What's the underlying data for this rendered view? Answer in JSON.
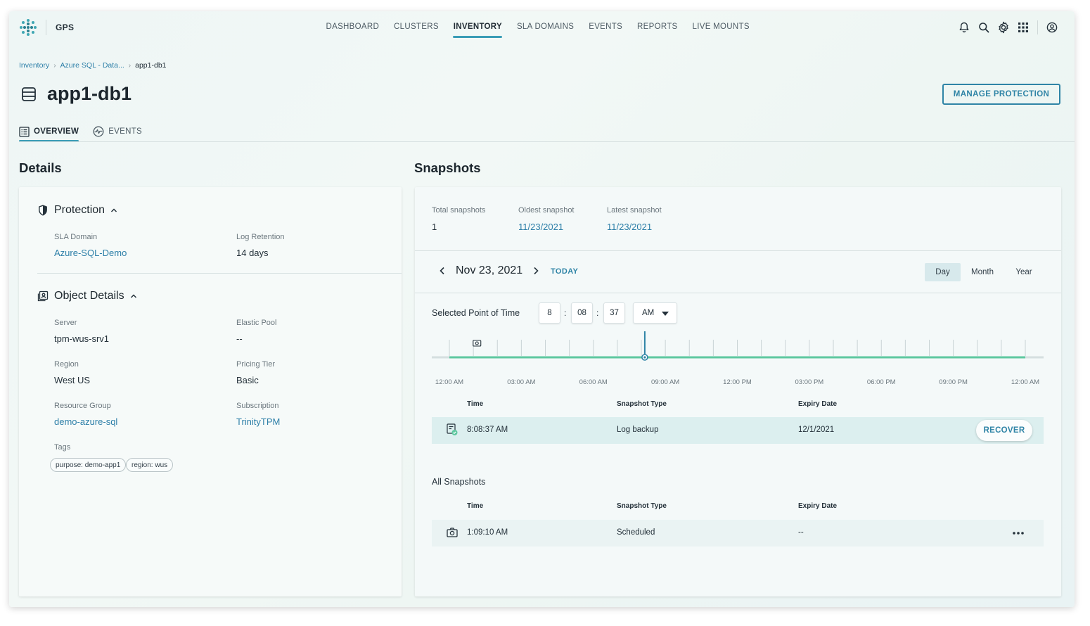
{
  "topnav": {
    "brand": "GPS",
    "items": [
      {
        "label": "DASHBOARD",
        "active": false
      },
      {
        "label": "CLUSTERS",
        "active": false
      },
      {
        "label": "INVENTORY",
        "active": true
      },
      {
        "label": "SLA DOMAINS",
        "active": false
      },
      {
        "label": "EVENTS",
        "active": false
      },
      {
        "label": "REPORTS",
        "active": false
      },
      {
        "label": "LIVE MOUNTS",
        "active": false
      }
    ],
    "icons": [
      "bell-icon",
      "search-icon",
      "gear-icon",
      "apps-grid-icon",
      "user-icon"
    ]
  },
  "breadcrumb": {
    "items": [
      "Inventory",
      "Azure SQL - Data...",
      "app1-db1"
    ]
  },
  "page": {
    "title": "app1-db1",
    "manage_button": "MANAGE PROTECTION",
    "tabs": [
      "OVERVIEW",
      "EVENTS"
    ]
  },
  "details": {
    "heading": "Details",
    "protection": {
      "title": "Protection",
      "sla_label": "SLA Domain",
      "sla_value": "Azure-SQL-Demo",
      "retention_label": "Log Retention",
      "retention_value": "14 days"
    },
    "object": {
      "title": "Object Details",
      "server_label": "Server",
      "server_value": "tpm-wus-srv1",
      "pool_label": "Elastic Pool",
      "pool_value": "--",
      "region_label": "Region",
      "region_value": "West US",
      "tier_label": "Pricing Tier",
      "tier_value": "Basic",
      "rg_label": "Resource Group",
      "rg_value": "demo-azure-sql",
      "sub_label": "Subscription",
      "sub_value": "TrinityTPM",
      "tags_label": "Tags",
      "tags": [
        "purpose: demo-app1",
        "region: wus"
      ]
    }
  },
  "snapshots": {
    "heading": "Snapshots",
    "total_label": "Total snapshots",
    "total_value": "1",
    "oldest_label": "Oldest snapshot",
    "oldest_value": "11/23/2021",
    "latest_label": "Latest snapshot",
    "latest_value": "11/23/2021",
    "date": "Nov 23, 2021",
    "today": "TODAY",
    "ranges": [
      "Day",
      "Month",
      "Year"
    ],
    "active_range": "Day",
    "spt_label": "Selected Point of Time",
    "time": {
      "hour": "8",
      "minute": "08",
      "second": "37",
      "ampm": "AM"
    },
    "timeline": {
      "labels": [
        "12:00 AM",
        "03:00 AM",
        "06:00 AM",
        "09:00 AM",
        "12:00 PM",
        "03:00 PM",
        "06:00 PM",
        "09:00 PM",
        "12:00 AM"
      ],
      "selected_hours": 8.1436,
      "snapshot_hours": 1.15
    },
    "columns": [
      "Time",
      "Snapshot Type",
      "Expiry Date"
    ],
    "selected_row": {
      "time": "8:08:37 AM",
      "type": "Log backup",
      "expiry": "12/1/2021",
      "action": "RECOVER"
    },
    "all_heading": "All Snapshots",
    "all_rows": [
      {
        "time": "1:09:10 AM",
        "type": "Scheduled",
        "expiry": "--"
      }
    ]
  },
  "colors": {
    "accent": "#2f84a6",
    "timeline": "#5ec8a0"
  }
}
